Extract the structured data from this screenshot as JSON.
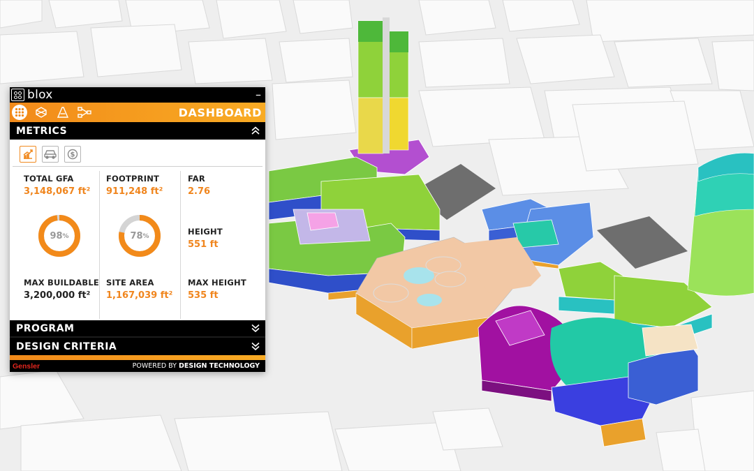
{
  "app": {
    "name": "blox",
    "minimize": "–"
  },
  "toolbar": {
    "title": "DASHBOARD",
    "buttons": [
      {
        "icon": "dashboard-grid-icon",
        "active": true
      },
      {
        "icon": "site-massing-icon",
        "active": false
      },
      {
        "icon": "zoning-letter-a-icon",
        "active": false
      },
      {
        "icon": "network-flow-icon",
        "active": false
      }
    ]
  },
  "metrics_section": {
    "label": "METRICS",
    "tabs": [
      {
        "icon": "chart-growth-icon",
        "active": true
      },
      {
        "icon": "car-parking-icon",
        "active": false
      },
      {
        "icon": "dollar-cost-icon",
        "active": false
      }
    ],
    "total_gfa": {
      "label": "TOTAL GFA",
      "value": "3,148,067 ft²"
    },
    "footprint": {
      "label": "FOOTPRINT",
      "value": "911,248 ft²"
    },
    "far": {
      "label": "FAR",
      "value": "2.76"
    },
    "height": {
      "label": "HEIGHT",
      "value": "551 ft"
    },
    "gfa_ratio": {
      "value": "98",
      "unit": "%",
      "fraction": 0.98
    },
    "site_ratio": {
      "value": "78",
      "unit": "%",
      "fraction": 0.78
    },
    "max_buildable": {
      "label": "MAX BUILDABLE",
      "value": "3,200,000 ft²"
    },
    "site_area": {
      "label": "SITE AREA",
      "value": "1,167,039 ft²"
    },
    "max_height": {
      "label": "MAX HEIGHT",
      "value": "535 ft"
    }
  },
  "program_section": {
    "label": "PROGRAM"
  },
  "design_criteria_section": {
    "label": "DESIGN CRITERIA"
  },
  "footer": {
    "brand": "Gensler",
    "powered_prefix": "POWERED BY ",
    "powered_strong": "DESIGN TECHNOLOGY"
  },
  "colors": {
    "accent": "#f28a1a",
    "ring_track": "#d4d4d4",
    "brand_red": "#e3261d"
  }
}
